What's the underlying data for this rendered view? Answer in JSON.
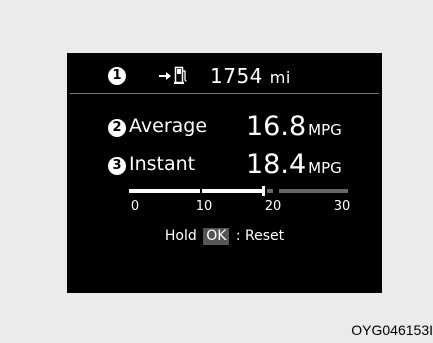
{
  "trip_computer": {
    "range": {
      "badge": "1",
      "value": "1754",
      "unit": "mi",
      "icons": [
        "arrow-right-icon",
        "fuel-pump-icon"
      ]
    },
    "average": {
      "badge": "2",
      "label": "Average",
      "value": "16.8",
      "unit": "MPG"
    },
    "instant": {
      "badge": "3",
      "label": "Instant",
      "value": "18.4",
      "unit": "MPG",
      "gauge": {
        "min": 0,
        "max": 30,
        "value": 18.4,
        "ticks": [
          "0",
          "10",
          "20",
          "30"
        ]
      }
    },
    "reset": {
      "prefix": "Hold",
      "key": "OK",
      "suffix": ": Reset"
    }
  },
  "image_code": "OYG046153I",
  "colors": {
    "page_background": "#ebebeb",
    "screen_background": "#000000",
    "text": "#ffffff",
    "gauge_filled": "#ffffff",
    "gauge_unfilled": "#666666",
    "key_background": "#555555"
  }
}
